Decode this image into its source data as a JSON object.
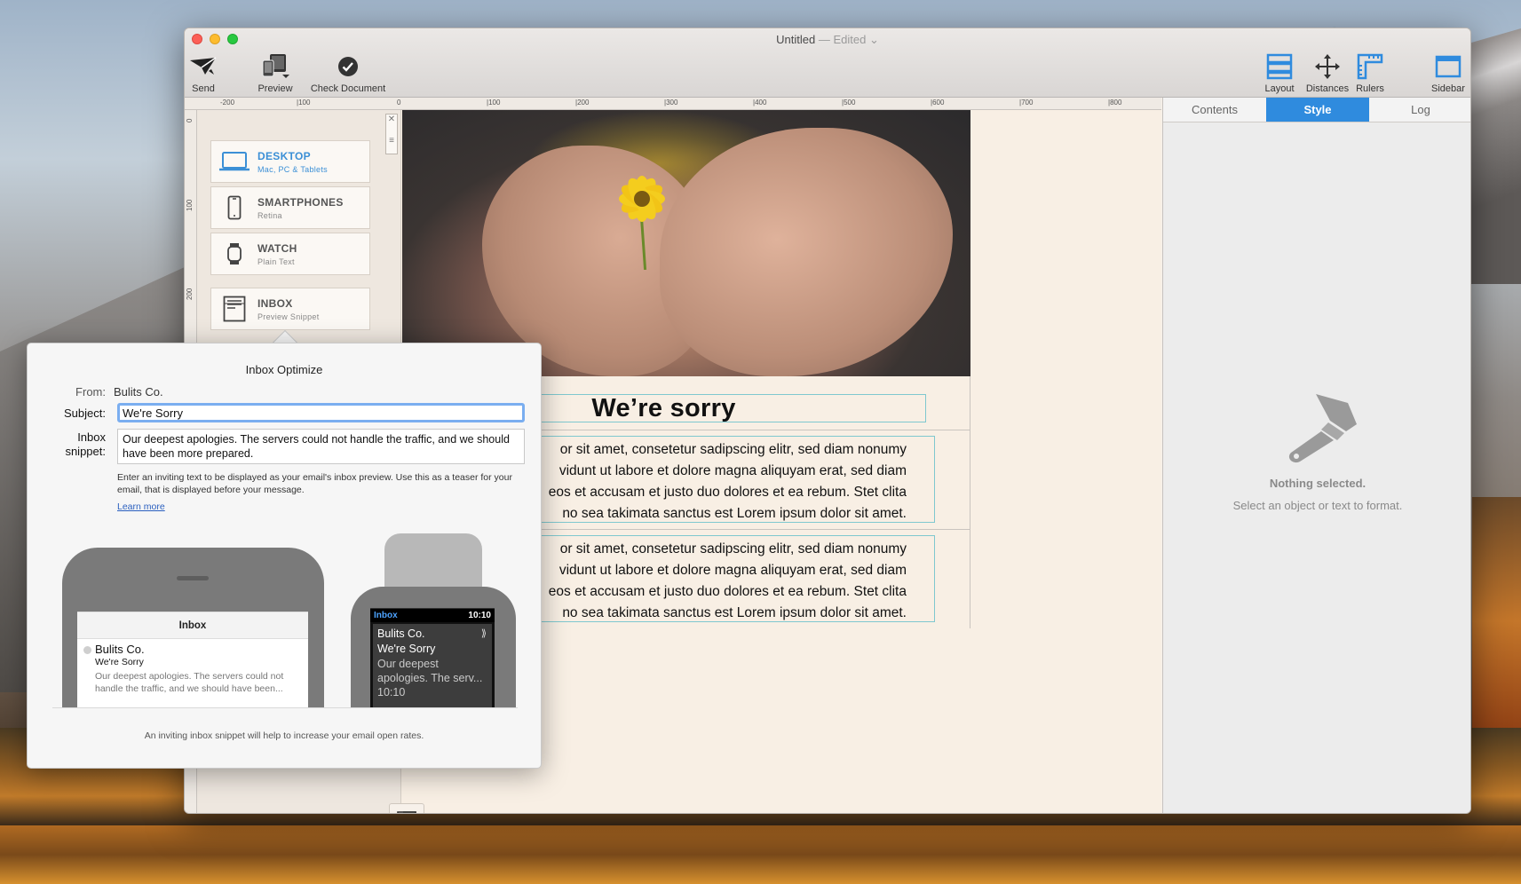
{
  "window": {
    "title": "Untitled",
    "title_edited": "— Edited",
    "title_chevron": "⌄"
  },
  "toolbar": {
    "send": "Send",
    "preview": "Preview",
    "check_document": "Check Document",
    "layout": "Layout",
    "distances": "Distances",
    "rulers": "Rulers",
    "sidebar": "Sidebar"
  },
  "ruler": {
    "top_labels": [
      "-200",
      "|100",
      "0",
      "|100",
      "|200",
      "|300",
      "|400",
      "|500",
      "|600",
      "|700",
      "|800"
    ],
    "left_labels": [
      "0",
      "100",
      "200"
    ]
  },
  "devices": [
    {
      "name": "DESKTOP",
      "sub": "Mac, PC & Tablets",
      "icon": "laptop-icon"
    },
    {
      "name": "SMARTPHONES",
      "sub": "Retina",
      "icon": "smartphone-icon"
    },
    {
      "name": "WATCH",
      "sub": "Plain Text",
      "icon": "watch-icon"
    },
    {
      "name": "INBOX",
      "sub": "Preview Snippet",
      "icon": "inbox-icon"
    }
  ],
  "email": {
    "heading": "We’re sorry",
    "para1": [
      "or sit amet, consetetur sadipscing elitr, sed diam nonumy",
      "vidunt ut labore et dolore magna aliquyam erat, sed diam",
      "eos et accusam et justo duo dolores et ea rebum. Stet clita",
      "no sea takimata sanctus est Lorem ipsum dolor sit amet."
    ],
    "para2": [
      "or sit amet, consetetur sadipscing elitr, sed diam nonumy",
      "vidunt ut labore et dolore magna aliquyam erat, sed diam",
      "eos et accusam et justo duo dolores et ea rebum. Stet clita",
      "no sea takimata sanctus est Lorem ipsum dolor sit amet."
    ]
  },
  "right_panel": {
    "tabs": [
      "Contents",
      "Style",
      "Log"
    ],
    "active_tab": "Style",
    "nothing_title": "Nothing selected.",
    "nothing_sub": "Select an object or text to format."
  },
  "popover": {
    "title": "Inbox Optimize",
    "from_label": "From:",
    "from_value": "Bulits Co.",
    "subject_label": "Subject:",
    "subject_value": "We're Sorry",
    "snippet_label_1": "Inbox",
    "snippet_label_2": "snippet:",
    "snippet_value": "Our deepest apologies. The servers could not handle the traffic, and we should have been more prepared.",
    "help_text": "Enter an inviting text to be displayed as your email's inbox preview. Use this as a teaser for your email, that is displayed before your message.",
    "learn_more": "Learn more",
    "phone": {
      "header": "Inbox",
      "from": "Bulits Co.",
      "subject": "We're Sorry",
      "snippet": "Our deepest apologies. The servers could not handle the traffic, and we should have been..."
    },
    "watch": {
      "app": "Inbox",
      "time": "10:10",
      "from": "Bulits Co.",
      "subject": "We're Sorry",
      "snippet_1": "Our deepest",
      "snippet_2": "apologies. The serv...",
      "stamp": "10:10",
      "chevron": "⟫"
    },
    "footer": "An inviting inbox snippet will help to increase your email open rates."
  },
  "colors": {
    "accent": "#2f8bde",
    "guide": "#7fc8cf"
  }
}
